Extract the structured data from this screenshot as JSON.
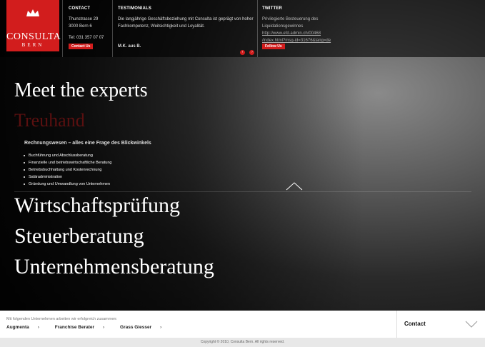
{
  "logo": {
    "name": "CONSULTA",
    "city": "BERN"
  },
  "contact": {
    "heading": "CONTACT",
    "street": "Thunstrasse 29",
    "zip_city": "3000 Bern 6",
    "phone": "Tel: 031 357 07 07",
    "button": "Contact Us"
  },
  "testimonials": {
    "heading": "TESTIMONIALS",
    "text": "Die langjährige Geschäftsbeziehung mit Consulta ist geprägt von hoher Fachkompetenz, Weitsichtigkeit und Loyalität.",
    "author": "M.K. aus B.",
    "prev": "‹",
    "next": "›"
  },
  "twitter": {
    "heading": "TWITTER",
    "text": "Privilegierte Besteuerung des Liquidationsgewinnes",
    "link1": "http://www.efd.admin.ch/00468",
    "link2": "/index.html?msg-id=31676&lang=de",
    "button": "Follow Us"
  },
  "hero": {
    "headline": "Meet the experts",
    "active_service": "Treuhand",
    "subheading": "Rechnungswesen – alles eine Frage des Blickwinkels",
    "services": [
      "Buchführung und Abschlussberatung",
      "Finanzielle und betriebswirtschaftliche Beratung",
      "Betriebsbuchhaltung und Kostenrechnung",
      "Saläradministration",
      "Gründung und Umwandlung von Unternehmen"
    ],
    "nav": [
      "Wirtschaftsprüfung",
      "Steuerberatung",
      "Unternehmensberatung"
    ]
  },
  "partners": {
    "label": "Mit folgenden Unternehmen arbeiten wir erfolgreich zusammen:",
    "items": [
      "Augmenta",
      "Franchise Berater",
      "Grass Giesser"
    ],
    "chevron": "›"
  },
  "contact_tab": {
    "label": "Contact"
  },
  "footer": {
    "copyright": "Copyright © 2010, Consulta Bern. All rights reserved."
  },
  "colors": {
    "accent": "#d21d1d"
  }
}
